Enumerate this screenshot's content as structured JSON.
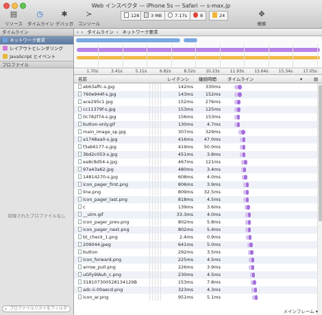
{
  "window": {
    "title": "Web インスペクタ — iPhone 5s — Safari — s-max.jp"
  },
  "toolbar": {
    "buttons": [
      {
        "label": "リソース",
        "icon": "resources-icon"
      },
      {
        "label": "タイムライン",
        "icon": "timeline-icon"
      },
      {
        "label": "デバッガ",
        "icon": "debugger-icon"
      },
      {
        "label": "コンソール",
        "icon": "console-icon"
      }
    ],
    "stats": {
      "resources": "128",
      "size": "3 MB",
      "time": "7.17s",
      "errors": "8",
      "warnings": "24"
    },
    "search_label": "検索"
  },
  "sidebar": {
    "timeline_header": "タイムライン",
    "items": [
      {
        "label": "ネットワーク要求",
        "selected": true
      },
      {
        "label": "レイアウトとレンダリング",
        "selected": false
      },
      {
        "label": "JavaScript とイベント",
        "selected": false
      }
    ],
    "profile_header": "プロファイル",
    "profile_empty": "収録されたプロファイルなし",
    "filter_placeholder": "プロファイルリストをフィルタ"
  },
  "breadcrumb": [
    "タイムライン",
    "ネットワーク要求"
  ],
  "overview": {
    "ticks": [
      "1.70s",
      "3.41s",
      "5.11s",
      "6.82s",
      "8.52s",
      "10.23s",
      "11.93s",
      "13.64s",
      "15.34s",
      "17.05s"
    ]
  },
  "table": {
    "columns": {
      "name": "名前",
      "latency": "レイテンシ",
      "duration": "継続時間",
      "timeline": "タイムライン"
    },
    "rows": [
      {
        "name": "ab63affc-s.jpg",
        "latency": "142ms",
        "duration": "330ms"
      },
      {
        "name": "760e944f-s.jpg",
        "latency": "143ms",
        "duration": "152ms"
      },
      {
        "name": "ace295c1.jpg",
        "latency": "152ms",
        "duration": "276ms"
      },
      {
        "name": "cc11379f-s.jpg",
        "latency": "153ms",
        "duration": "125ms"
      },
      {
        "name": "0c782f74-s.jpg",
        "latency": "156ms",
        "duration": "153ms"
      },
      {
        "name": "button-only.gif",
        "latency": "130ms",
        "duration": "4.7ms"
      },
      {
        "name": "main_image_sp.jpg",
        "latency": "307ms",
        "duration": "329ms"
      },
      {
        "name": "a1748aa0-s.jpg",
        "latency": "416ms",
        "duration": "47.0ms"
      },
      {
        "name": "f3ab6177-s.jpg",
        "latency": "419ms",
        "duration": "50.0ms"
      },
      {
        "name": "3bd2c053-s.jpg",
        "latency": "451ms",
        "duration": "3.8ms"
      },
      {
        "name": "ea8c8d54-s.jpg",
        "latency": "467ms",
        "duration": "121ms"
      },
      {
        "name": "97a43a62.jpg",
        "latency": "480ms",
        "duration": "3.4ms"
      },
      {
        "name": "14814270-s.jpg",
        "latency": "608ms",
        "duration": "4.0ms"
      },
      {
        "name": "icon_pager_first.png",
        "latency": "806ms",
        "duration": "3.9ms"
      },
      {
        "name": "line.png",
        "latency": "809ms",
        "duration": "32.5ms"
      },
      {
        "name": "icon_pager_last.png",
        "latency": "818ms",
        "duration": "4.5ms"
      },
      {
        "name": "c",
        "latency": "139ms",
        "duration": "3.6ms"
      },
      {
        "name": "__utm.gif",
        "latency": "33.3ms",
        "duration": "4.0ms"
      },
      {
        "name": "icon_pager_prev.png",
        "latency": "802ms",
        "duration": "5.8ms"
      },
      {
        "name": "icon_pager_next.png",
        "latency": "802ms",
        "duration": "5.4ms"
      },
      {
        "name": "bt_check_1.png",
        "latency": "2.4ms",
        "duration": "0.9ms"
      },
      {
        "name": "209044.jpeg",
        "latency": "641ms",
        "duration": "5.0ms"
      },
      {
        "name": "button",
        "latency": "292ms",
        "duration": "3.5ms"
      },
      {
        "name": "icon_forward.png",
        "latency": "225ms",
        "duration": "4.5ms"
      },
      {
        "name": "arrow_pull.png",
        "latency": "226ms",
        "duration": "3.9ms"
      },
      {
        "name": "uGFy9lAuh_c.png",
        "latency": "230ms",
        "duration": "4.5ms"
      },
      {
        "name": "318107300528134129B",
        "latency": "153ms",
        "duration": "7.8ms"
      },
      {
        "name": "adc-ii-00aecd.png",
        "latency": "323ms",
        "duration": "4.3ms"
      },
      {
        "name": "icon_ar.png",
        "latency": "951ms",
        "duration": "5.1ms"
      }
    ],
    "bars": [
      [
        0.08,
        0.08
      ],
      [
        0.08,
        0.08
      ],
      [
        0.08,
        0.07
      ],
      [
        0.08,
        0.07
      ],
      [
        0.08,
        0.06
      ],
      [
        0.08,
        0.05
      ],
      [
        0.12,
        0.08
      ],
      [
        0.14,
        0.06
      ],
      [
        0.14,
        0.06
      ],
      [
        0.14,
        0.06
      ],
      [
        0.15,
        0.07
      ],
      [
        0.15,
        0.06
      ],
      [
        0.16,
        0.05
      ],
      [
        0.18,
        0.06
      ],
      [
        0.18,
        0.06
      ],
      [
        0.18,
        0.05
      ],
      [
        0.19,
        0.04
      ],
      [
        0.2,
        0.04
      ],
      [
        0.2,
        0.05
      ],
      [
        0.2,
        0.05
      ],
      [
        0.21,
        0.04
      ],
      [
        0.22,
        0.05
      ],
      [
        0.23,
        0.05
      ],
      [
        0.24,
        0.05
      ],
      [
        0.24,
        0.05
      ],
      [
        0.25,
        0.05
      ],
      [
        0.26,
        0.05
      ],
      [
        0.27,
        0.05
      ],
      [
        0.28,
        0.05
      ]
    ]
  },
  "status": {
    "frame_selector": "メインフレーム"
  }
}
